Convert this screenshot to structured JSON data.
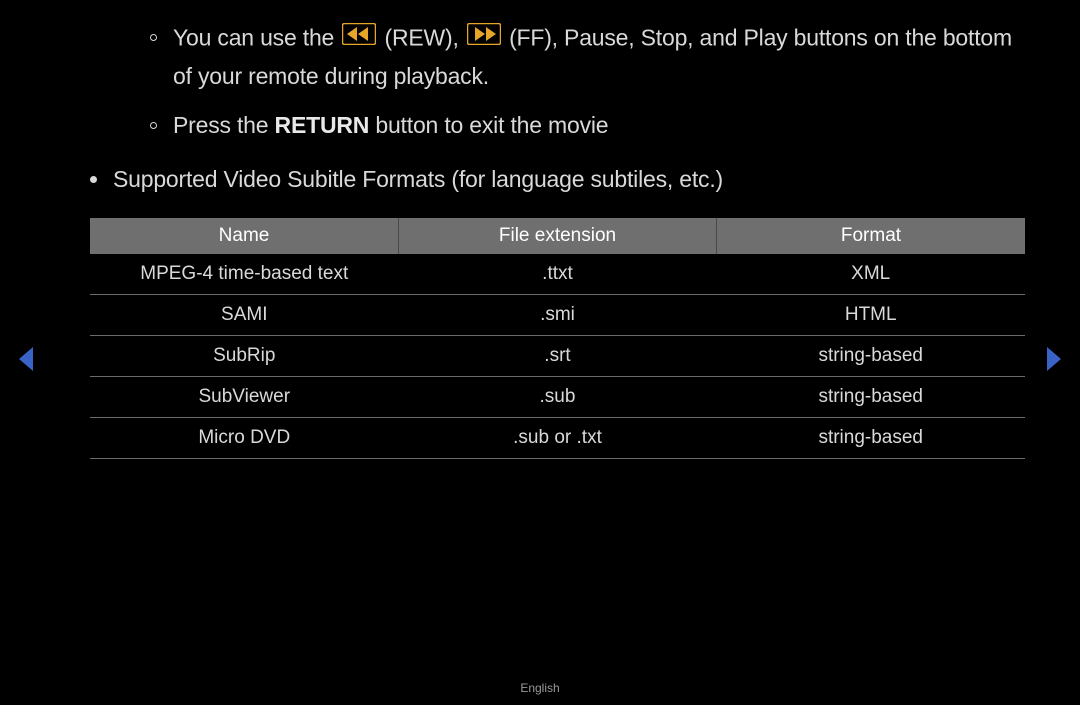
{
  "bullets": {
    "b1_pre": "You can use the ",
    "b1_rew": " (REW), ",
    "b1_ff": " (FF), Pause, Stop, and Play buttons on the bottom of your remote during playback.",
    "b2_pre": "Press the ",
    "b2_bold": "RETURN",
    "b2_post": " button to exit the movie",
    "b3": "Supported Video Subitle Formats (for language subtiles, etc.)"
  },
  "table": {
    "headers": [
      "Name",
      "File extension",
      "Format"
    ],
    "rows": [
      [
        "MPEG-4 time-based text",
        ".ttxt",
        "XML"
      ],
      [
        "SAMI",
        ".smi",
        "HTML"
      ],
      [
        "SubRip",
        ".srt",
        "string-based"
      ],
      [
        "SubViewer",
        ".sub",
        "string-based"
      ],
      [
        "Micro DVD",
        ".sub or .txt",
        "string-based"
      ]
    ]
  },
  "footer": "English"
}
